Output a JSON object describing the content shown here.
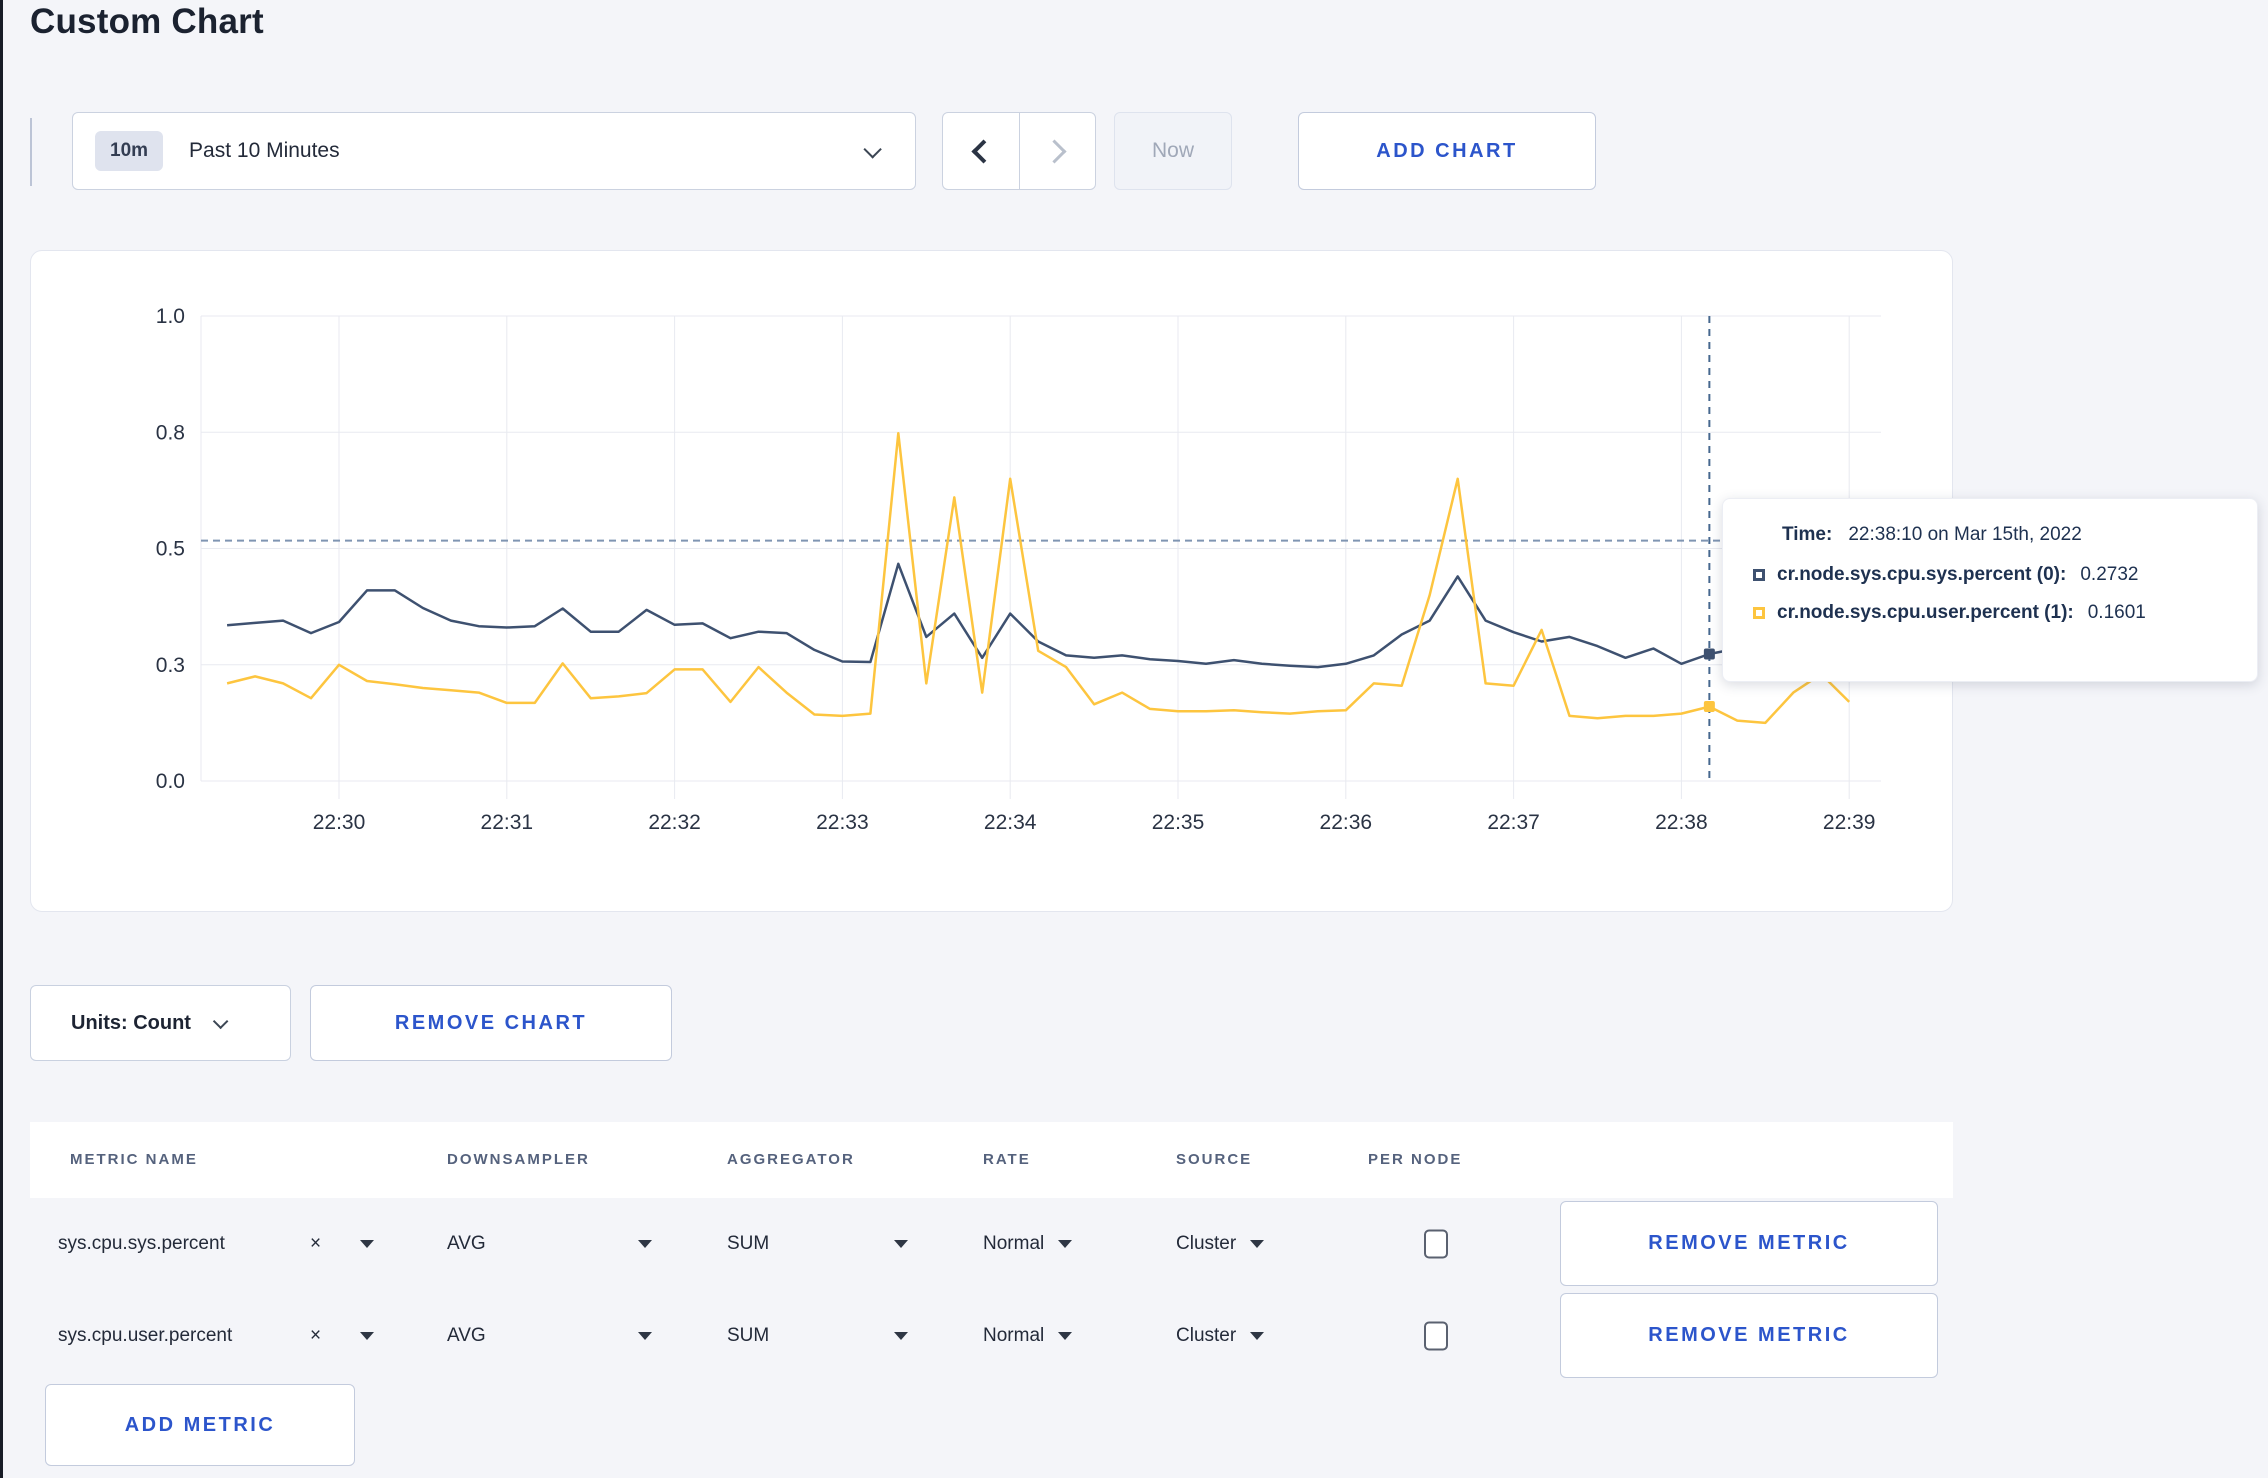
{
  "header": {
    "title": "Custom Chart"
  },
  "controls": {
    "range_badge": "10m",
    "range_label": "Past 10 Minutes",
    "now_label": "Now",
    "add_chart_label": "ADD CHART"
  },
  "chart_footer": {
    "units_label": "Units: Count",
    "remove_chart_label": "REMOVE CHART"
  },
  "tooltip": {
    "time_label": "Time:",
    "time_value": "22:38:10 on Mar 15th, 2022",
    "rows": [
      {
        "label": "cr.node.sys.cpu.sys.percent (0):",
        "value": "0.2732",
        "color": "#3e5170"
      },
      {
        "label": "cr.node.sys.cpu.user.percent (1):",
        "value": "0.1601",
        "color": "#fdc53f"
      }
    ]
  },
  "icons": {
    "clear_icon": "×"
  },
  "colors": {
    "accent_blue": "#2c55cb",
    "series_sys": "#3e5170",
    "series_user": "#fdc53f",
    "page_background": "#f4f5f9",
    "grid": "#e8eaf0"
  },
  "metrics_table": {
    "columns": [
      "METRIC NAME",
      "DOWNSAMPLER",
      "AGGREGATOR",
      "RATE",
      "SOURCE",
      "PER NODE"
    ],
    "remove_metric_label": "REMOVE METRIC",
    "add_metric_label": "ADD METRIC",
    "rows": [
      {
        "name": "sys.cpu.sys.percent",
        "downsampler": "AVG",
        "aggregator": "SUM",
        "rate": "Normal",
        "source": "Cluster",
        "per_node_checked": false
      },
      {
        "name": "sys.cpu.user.percent",
        "downsampler": "AVG",
        "aggregator": "SUM",
        "rate": "Normal",
        "source": "Cluster",
        "per_node_checked": false
      }
    ]
  },
  "chart_data": {
    "type": "line",
    "title": "",
    "xlabel": "",
    "ylabel": "",
    "ylim": [
      0,
      1
    ],
    "grid": true,
    "legend_position": "tooltip",
    "x_ticks": [
      "22:30",
      "22:31",
      "22:32",
      "22:33",
      "22:34",
      "22:35",
      "22:36",
      "22:37",
      "22:38",
      "22:39"
    ],
    "y_ticks": {
      "labels": [
        "0.0",
        "0.3",
        "0.5",
        "0.8",
        "1.0"
      ],
      "values": [
        0,
        0.25,
        0.5,
        0.75,
        1.0
      ]
    },
    "x_start_time": "22:29:20",
    "x_start_offset_seconds": -40,
    "x_step_seconds": 10,
    "series": [
      {
        "id": "sys",
        "name": "cr.node.sys.cpu.sys.percent",
        "color": "#3e5170",
        "values": [
          0.335,
          0.34,
          0.345,
          0.318,
          0.342,
          0.41,
          0.41,
          0.372,
          0.345,
          0.333,
          0.33,
          0.333,
          0.371,
          0.321,
          0.321,
          0.368,
          0.336,
          0.339,
          0.307,
          0.321,
          0.318,
          0.282,
          0.257,
          0.256,
          0.467,
          0.31,
          0.36,
          0.265,
          0.36,
          0.3,
          0.27,
          0.265,
          0.27,
          0.262,
          0.258,
          0.252,
          0.26,
          0.252,
          0.248,
          0.245,
          0.252,
          0.27,
          0.315,
          0.345,
          0.44,
          0.345,
          0.32,
          0.3,
          0.31,
          0.29,
          0.265,
          0.285,
          0.252,
          0.2732,
          0.285,
          0.3,
          0.295,
          0.3,
          0.3
        ]
      },
      {
        "id": "user",
        "name": "cr.node.sys.cpu.user.percent",
        "color": "#fdc53f",
        "values": [
          0.21,
          0.225,
          0.21,
          0.178,
          0.25,
          0.215,
          0.208,
          0.2,
          0.195,
          0.19,
          0.168,
          0.168,
          0.253,
          0.178,
          0.182,
          0.189,
          0.24,
          0.24,
          0.17,
          0.245,
          0.19,
          0.143,
          0.14,
          0.145,
          0.748,
          0.21,
          0.61,
          0.19,
          0.65,
          0.28,
          0.245,
          0.165,
          0.19,
          0.155,
          0.15,
          0.15,
          0.152,
          0.148,
          0.145,
          0.15,
          0.152,
          0.21,
          0.205,
          0.4,
          0.65,
          0.21,
          0.205,
          0.325,
          0.14,
          0.135,
          0.14,
          0.14,
          0.145,
          0.1601,
          0.13,
          0.125,
          0.19,
          0.23,
          0.17
        ]
      }
    ],
    "crosshair": {
      "time": "22:38:10",
      "offset_seconds": 490,
      "hline_value": 0.517,
      "values": [
        0.2732,
        0.1601
      ]
    }
  }
}
